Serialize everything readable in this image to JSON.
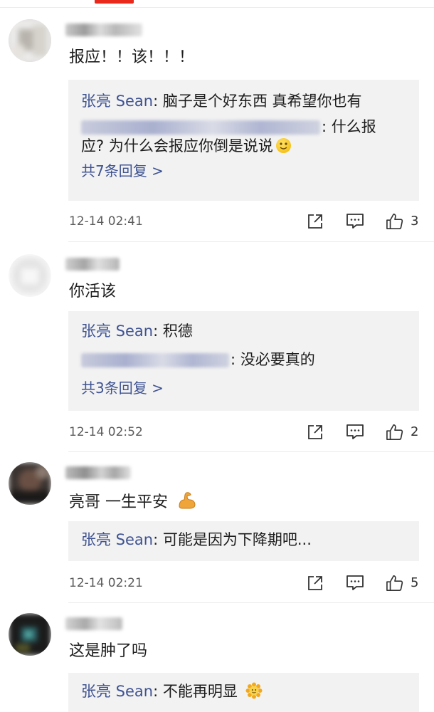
{
  "comments": [
    {
      "text": "报应！！该！！！",
      "reply": {
        "line1_author": "张亮 Sean",
        "line1_text": ": 脑子是个好东西 真希望你也有",
        "line2_text": ": 什么报",
        "line3_text": "应? 为什么会报应你倒是说说",
        "emoji": "smile-emoji",
        "more": "共7条回复 >"
      },
      "timestamp": "12-14 02:41",
      "likes": "3"
    },
    {
      "text": "你活该",
      "reply": {
        "line1_author": "张亮 Sean",
        "line1_text": ": 积德",
        "line2_text": ": 没必要真的",
        "more": "共3条回复 >"
      },
      "timestamp": "12-14 02:52",
      "likes": "2"
    },
    {
      "text": "亮哥 一生平安",
      "emoji": "flexed-biceps-emoji",
      "reply": {
        "line1_author": "张亮 Sean",
        "line1_text": ": 可能是因为下降期吧..."
      },
      "timestamp": "12-14 02:21",
      "likes": "5"
    },
    {
      "text": "这是肿了吗",
      "reply": {
        "line1_author": "张亮 Sean",
        "line1_text": ": 不能再明显",
        "emoji": "sunflower-emoji"
      }
    }
  ],
  "icons": {
    "share": "share-icon",
    "reply": "reply-comment-icon",
    "like": "thumbs-up-icon"
  },
  "colors": {
    "accent": "#e8291c",
    "author_link": "#3f5392",
    "reply_bg": "#f2f2f2"
  }
}
